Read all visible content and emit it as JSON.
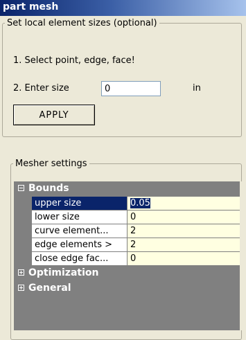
{
  "title": "part mesh",
  "local_sizes": {
    "legend": "Set local element sizes (optional)",
    "step1": "1. Select point, edge, face!",
    "step2": "2. Enter size",
    "size_value": "0",
    "unit": "in",
    "apply_label": "APPLY"
  },
  "mesher": {
    "legend": "Mesher settings",
    "categories": [
      {
        "label": "Bounds",
        "expanded": true,
        "properties": [
          {
            "name": "upper size",
            "value": "0.05",
            "selected": true
          },
          {
            "name": "lower size",
            "value": "0"
          },
          {
            "name": "curve element...",
            "value": "2"
          },
          {
            "name": "edge elements >",
            "value": "2"
          },
          {
            "name": "close edge fac...",
            "value": "0"
          }
        ]
      },
      {
        "label": "Optimization",
        "expanded": false
      },
      {
        "label": "General",
        "expanded": false
      }
    ]
  },
  "colors": {
    "title_bar": "#0a246a",
    "selection": "#0a246a",
    "value_cell": "#ffffe1",
    "category_bg": "#808080"
  }
}
